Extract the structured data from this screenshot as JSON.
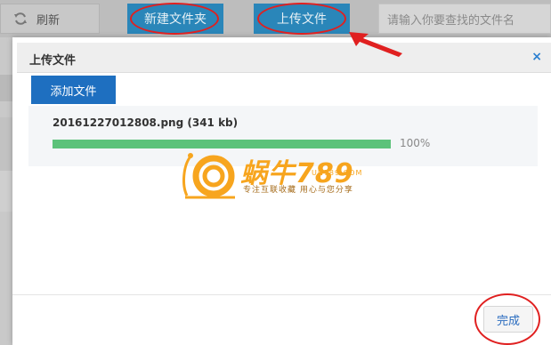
{
  "toolbar": {
    "refresh_label": "刷新",
    "new_folder_label": "新建文件夹",
    "upload_label": "上传文件",
    "search_placeholder": "请输入你要查找的文件名"
  },
  "dialog": {
    "title": "上传文件",
    "close_icon": "×",
    "add_file_label": "添加文件",
    "file": {
      "name_size": "20161227012808.png (341 kb)",
      "progress_percent": 100,
      "progress_label": "100%"
    },
    "done_label": "完成"
  },
  "watermark": {
    "title": "蜗牛789",
    "url": "UN789.COM",
    "slogan": "专注互联收藏  用心与您分享"
  },
  "colors": {
    "accent_blue": "#1e6fc0",
    "toolbar_blue": "#2a86b9",
    "progress_green": "#5cc27a",
    "annotation_red": "#e02020",
    "watermark_orange": "#f7a51e"
  }
}
